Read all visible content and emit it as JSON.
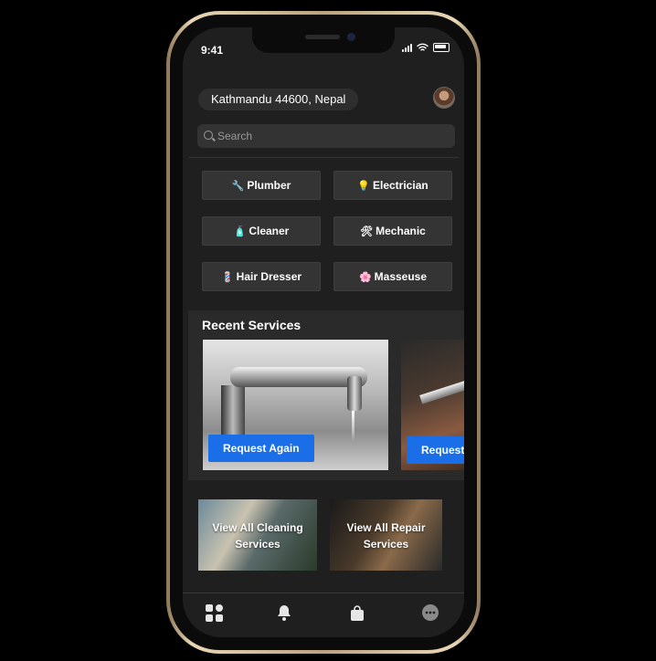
{
  "status_bar": {
    "time": "9:41"
  },
  "header": {
    "location": "Kathmandu 44600, Nepal"
  },
  "search": {
    "placeholder": "Search"
  },
  "categories": [
    {
      "label": "Plumber",
      "icon": "wrench-icon",
      "glyph": "🔧"
    },
    {
      "label": "Electrician",
      "icon": "lightbulb-icon",
      "glyph": "💡"
    },
    {
      "label": "Cleaner",
      "icon": "spray-bottle-icon",
      "glyph": "🧴"
    },
    {
      "label": "Mechanic",
      "icon": "tools-icon",
      "glyph": "🛠"
    },
    {
      "label": "Hair Dresser",
      "icon": "barber-pole-icon",
      "glyph": "💈"
    },
    {
      "label": "Masseuse",
      "icon": "flower-icon",
      "glyph": "🌸"
    }
  ],
  "recent": {
    "title": "Recent Services",
    "cards": [
      {
        "button": "Request Again"
      },
      {
        "button": "Request Again"
      }
    ]
  },
  "services": [
    {
      "label": "View All Cleaning Services"
    },
    {
      "label": "View All Repair Services"
    }
  ],
  "tabbar": [
    {
      "icon": "dashboard-grid-icon"
    },
    {
      "icon": "bell-icon"
    },
    {
      "icon": "shopping-bag-icon"
    },
    {
      "icon": "chat-bubble-icon"
    }
  ],
  "colors": {
    "accent": "#1a6fe8",
    "background": "#1f1f1f",
    "frame": "#d8c4a0"
  }
}
